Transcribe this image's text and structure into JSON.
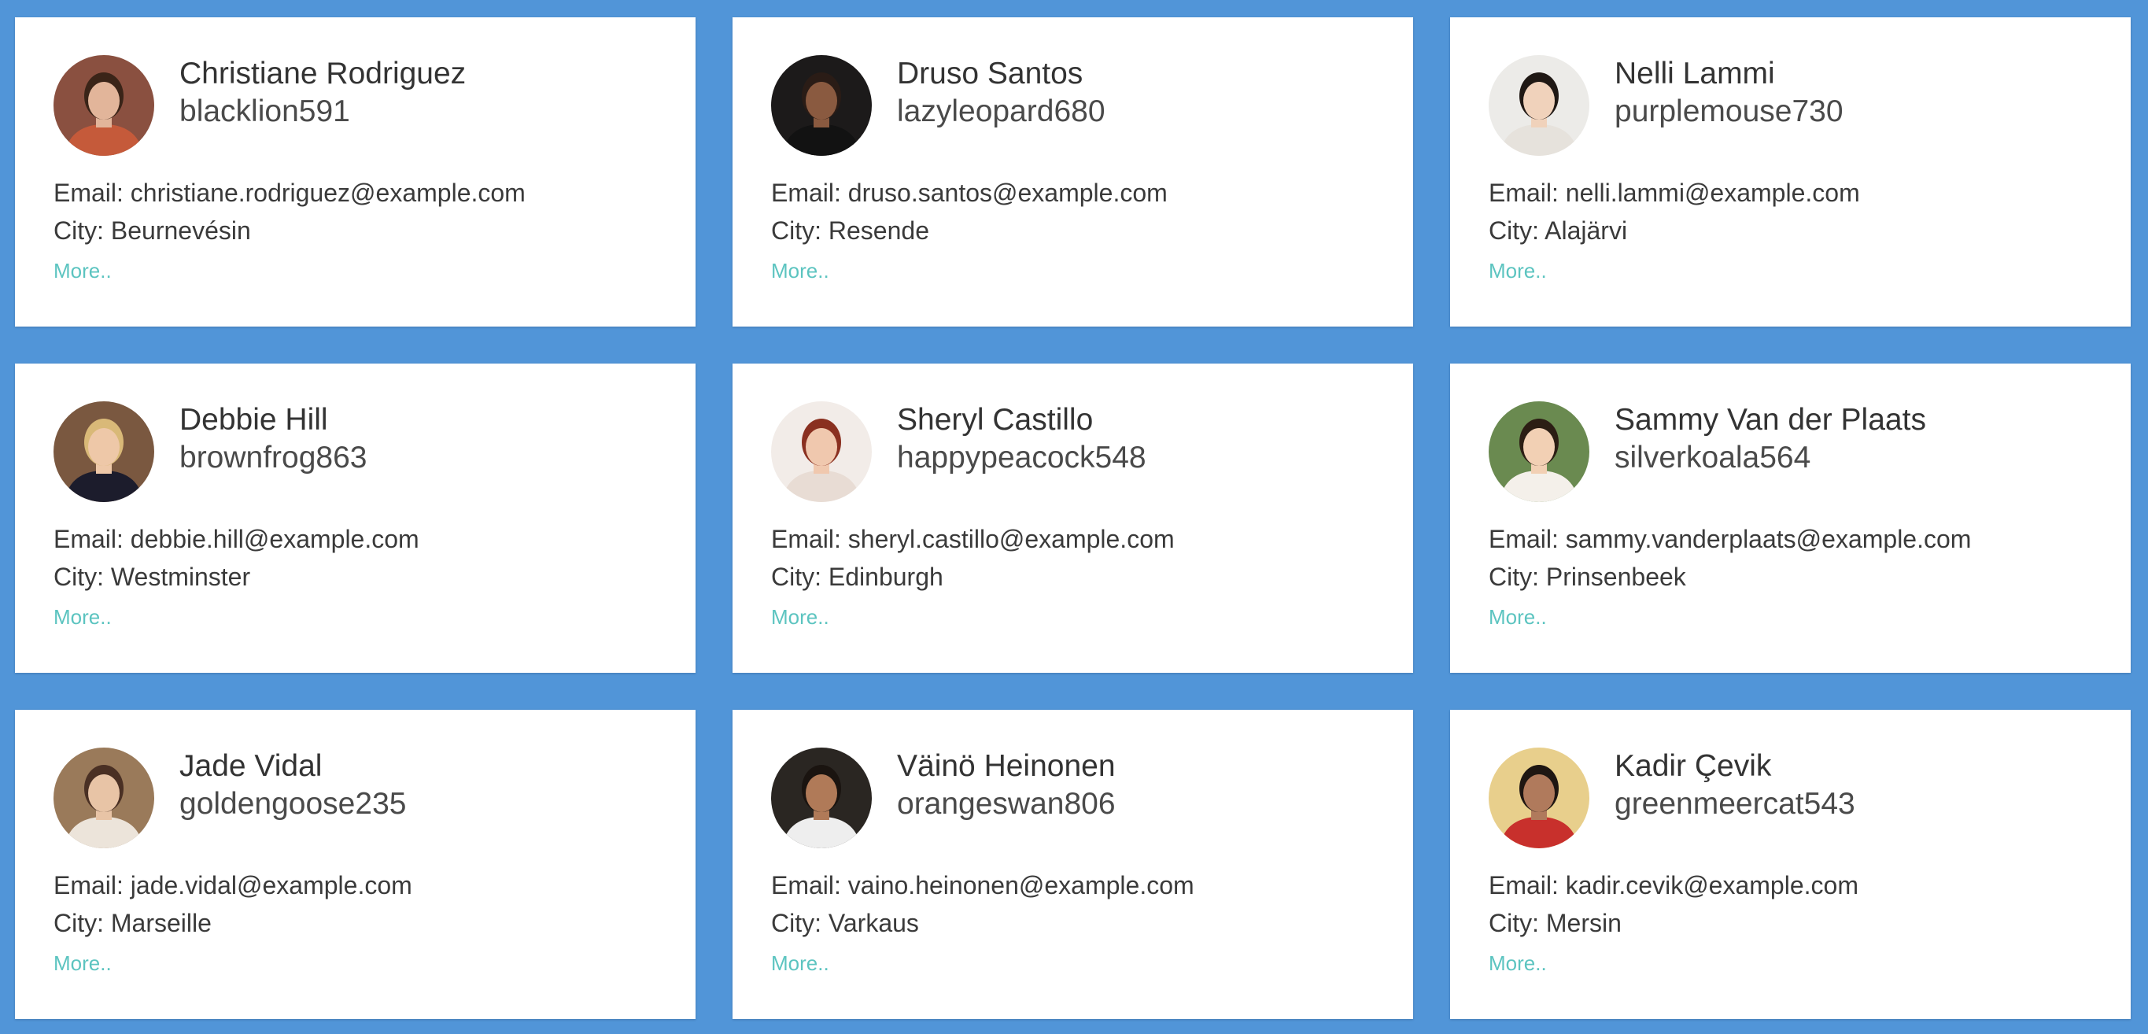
{
  "labels": {
    "email_prefix": "Email: ",
    "city_prefix": "City: ",
    "more": "More.."
  },
  "users": [
    {
      "name": "Christiane Rodriguez",
      "username": "blacklion591",
      "email": "christiane.rodriguez@example.com",
      "city": "Beurnevésin",
      "avatar": {
        "bg": "#8a5040",
        "skin": "#e2b59a",
        "hair": "#3a2418",
        "shirt": "#c55a3a"
      }
    },
    {
      "name": "Druso Santos",
      "username": "lazyleopard680",
      "email": "druso.santos@example.com",
      "city": "Resende",
      "avatar": {
        "bg": "#1c1a1a",
        "skin": "#8a5a40",
        "hair": "#2a1c16",
        "shirt": "#121212"
      }
    },
    {
      "name": "Nelli Lammi",
      "username": "purplemouse730",
      "email": "nelli.lammi@example.com",
      "city": "Alajärvi",
      "avatar": {
        "bg": "#ecebe8",
        "skin": "#f0d2bb",
        "hair": "#1f1814",
        "shirt": "#e6e2dc"
      }
    },
    {
      "name": "Debbie Hill",
      "username": "brownfrog863",
      "email": "debbie.hill@example.com",
      "city": "Westminster",
      "avatar": {
        "bg": "#7a5840",
        "skin": "#eec8a8",
        "hair": "#d9b978",
        "shirt": "#1c1c2c"
      }
    },
    {
      "name": "Sheryl Castillo",
      "username": "happypeacock548",
      "email": "sheryl.castillo@example.com",
      "city": "Edinburgh",
      "avatar": {
        "bg": "#f2ece8",
        "skin": "#f0c8ae",
        "hair": "#8a3020",
        "shirt": "#e8dcd4"
      }
    },
    {
      "name": "Sammy Van der Plaats",
      "username": "silverkoala564",
      "email": "sammy.vanderplaats@example.com",
      "city": "Prinsenbeek",
      "avatar": {
        "bg": "#6a8a50",
        "skin": "#f2d0b4",
        "hair": "#2c1e14",
        "shirt": "#f4f0ea"
      }
    },
    {
      "name": "Jade Vidal",
      "username": "goldengoose235",
      "email": "jade.vidal@example.com",
      "city": "Marseille",
      "avatar": {
        "bg": "#9a7a5a",
        "skin": "#e8c4a6",
        "hair": "#4a3024",
        "shirt": "#ece4da"
      }
    },
    {
      "name": "Väinö Heinonen",
      "username": "orangeswan806",
      "email": "vaino.heinonen@example.com",
      "city": "Varkaus",
      "avatar": {
        "bg": "#2a2622",
        "skin": "#b07a58",
        "hair": "#1a1410",
        "shirt": "#eeeeee"
      }
    },
    {
      "name": "Kadir Çevik",
      "username": "greenmeercat543",
      "email": "kadir.cevik@example.com",
      "city": "Mersin",
      "avatar": {
        "bg": "#e8cf8c",
        "skin": "#b07a5c",
        "hair": "#1e1612",
        "shirt": "#c8302c"
      }
    }
  ]
}
